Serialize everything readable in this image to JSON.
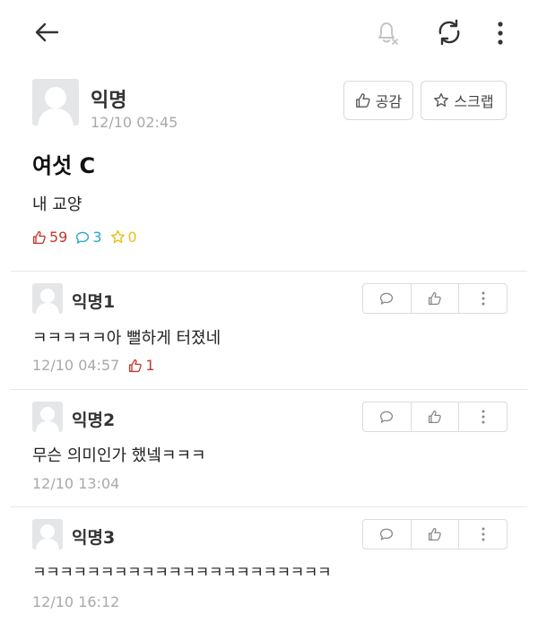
{
  "toolbar": {
    "back_icon": "arrow-left-icon",
    "bell_icon": "bell-off-icon",
    "refresh_icon": "refresh-icon",
    "more_icon": "more-vertical-icon"
  },
  "post": {
    "author": "익명",
    "time": "12/10 02:45",
    "like_button": "공감",
    "scrap_button": "스크랩",
    "title": "여섯 C",
    "body": "내 교양",
    "likes": "59",
    "comments": "3",
    "scraps": "0"
  },
  "comments": [
    {
      "author": "익명1",
      "text": "ㅋㅋㅋㅋㅋ아 뻘하게 터졌네",
      "time": "12/10 04:57",
      "likes": "1"
    },
    {
      "author": "익명2",
      "text": "무슨 의미인가 했넼ㅋㅋㅋ",
      "time": "12/10 13:04"
    },
    {
      "author": "익명3",
      "text": "ㅋㅋㅋㅋㅋㅋㅋㅋㅋㅋㅋㅋㅋㅋㅋㅋㅋㅋㅋㅋㅋㅋ",
      "time": "12/10 16:12"
    }
  ],
  "colors": {
    "like": "#c0392b",
    "comment": "#2aa7c9",
    "scrap": "#e5c21c",
    "muted": "#a9a9a9"
  }
}
